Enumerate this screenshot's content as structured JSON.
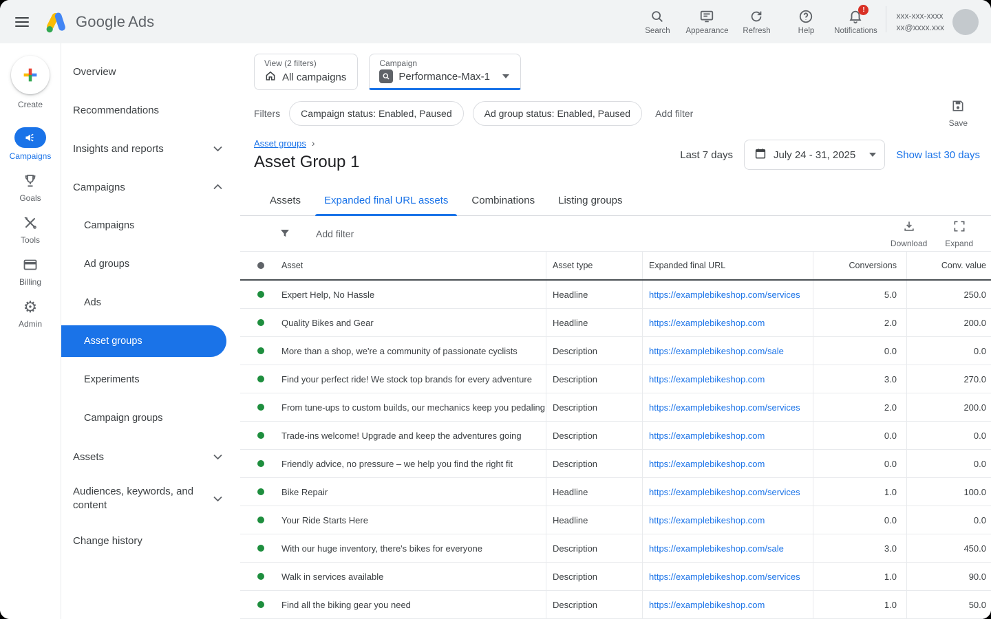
{
  "topbar": {
    "product": "Google",
    "product_suffix": "Ads",
    "search": "Search",
    "appearance": "Appearance",
    "refresh": "Refresh",
    "help": "Help",
    "notifications": "Notifications",
    "notification_badge": "!",
    "account_line1": "xxx-xxx-xxxx",
    "account_line2": "xx@xxxx.xxx"
  },
  "rail": {
    "create": "Create",
    "campaigns": "Campaigns",
    "goals": "Goals",
    "tools": "Tools",
    "billing": "Billing",
    "admin": "Admin"
  },
  "nav": {
    "overview": "Overview",
    "recommendations": "Recommendations",
    "insights": "Insights and reports",
    "campaigns": "Campaigns",
    "sub_campaigns": "Campaigns",
    "ad_groups": "Ad groups",
    "ads": "Ads",
    "asset_groups": "Asset groups",
    "experiments": "Experiments",
    "campaign_groups": "Campaign groups",
    "assets": "Assets",
    "audiences": "Audiences, keywords, and content",
    "change_history": "Change history"
  },
  "view_selector": {
    "label": "View (2 filters)",
    "value": "All campaigns"
  },
  "campaign_selector": {
    "label": "Campaign",
    "value": "Performance-Max-1"
  },
  "filters": {
    "label": "Filters",
    "chip1": "Campaign status: Enabled, Paused",
    "chip2": "Ad group status: Enabled, Paused",
    "add_filter": "Add filter",
    "save": "Save"
  },
  "page_header": {
    "breadcrumb": "Asset groups",
    "title": "Asset Group 1",
    "range_label": "Last 7 days",
    "date_range": "July 24 - 31, 2025",
    "show_last": "Show last 30 days"
  },
  "tabs": [
    "Assets",
    "Expanded final URL assets",
    "Combinations",
    "Listing groups"
  ],
  "active_tab": "Expanded final URL assets",
  "table": {
    "toolbar": {
      "add_filter": "Add filter",
      "download": "Download",
      "expand": "Expand"
    },
    "columns": [
      "Asset",
      "Asset type",
      "Expanded final URL",
      "Conversions",
      "Conv. value"
    ],
    "rows": [
      {
        "status": "enabled",
        "asset": "Expert Help, No Hassle",
        "type": "Headline",
        "url": "https://examplebikeshop.com/services",
        "conversions": "5.0",
        "conv_value": "250.0"
      },
      {
        "status": "enabled",
        "asset": "Quality Bikes and Gear",
        "type": "Headline",
        "url": "https://examplebikeshop.com",
        "conversions": "2.0",
        "conv_value": "200.0"
      },
      {
        "status": "enabled",
        "asset": "More than a shop, we're a community of passionate cyclists",
        "type": "Description",
        "url": "https://examplebikeshop.com/sale",
        "conversions": "0.0",
        "conv_value": "0.0"
      },
      {
        "status": "enabled",
        "asset": "Find your perfect ride! We stock top brands for every adventure",
        "type": "Description",
        "url": "https://examplebikeshop.com",
        "conversions": "3.0",
        "conv_value": "270.0"
      },
      {
        "status": "enabled",
        "asset": "From tune-ups to custom builds, our mechanics keep you pedaling",
        "type": "Description",
        "url": "https://examplebikeshop.com/services",
        "conversions": "2.0",
        "conv_value": "200.0"
      },
      {
        "status": "enabled",
        "asset": "Trade-ins welcome! Upgrade and keep the adventures going",
        "type": "Description",
        "url": "https://examplebikeshop.com",
        "conversions": "0.0",
        "conv_value": "0.0"
      },
      {
        "status": "enabled",
        "asset": "Friendly advice, no pressure – we help you find the right fit",
        "type": "Description",
        "url": "https://examplebikeshop.com",
        "conversions": "0.0",
        "conv_value": "0.0"
      },
      {
        "status": "enabled",
        "asset": "Bike Repair",
        "type": "Headline",
        "url": "https://examplebikeshop.com/services",
        "conversions": "1.0",
        "conv_value": "100.0"
      },
      {
        "status": "enabled",
        "asset": "Your Ride Starts Here",
        "type": "Headline",
        "url": "https://examplebikeshop.com",
        "conversions": "0.0",
        "conv_value": "0.0"
      },
      {
        "status": "enabled",
        "asset": "With our huge inventory, there's bikes for everyone",
        "type": "Description",
        "url": "https://examplebikeshop.com/sale",
        "conversions": "3.0",
        "conv_value": "450.0"
      },
      {
        "status": "enabled",
        "asset": "Walk in services available",
        "type": "Description",
        "url": "https://examplebikeshop.com/services",
        "conversions": "1.0",
        "conv_value": "90.0"
      },
      {
        "status": "enabled",
        "asset": "Find all the biking gear you need",
        "type": "Description",
        "url": "https://examplebikeshop.com",
        "conversions": "1.0",
        "conv_value": "50.0"
      }
    ]
  },
  "colors": {
    "accent": "#1a73e8",
    "enabled_green": "#1e8e3e",
    "badge_red": "#d93025"
  }
}
